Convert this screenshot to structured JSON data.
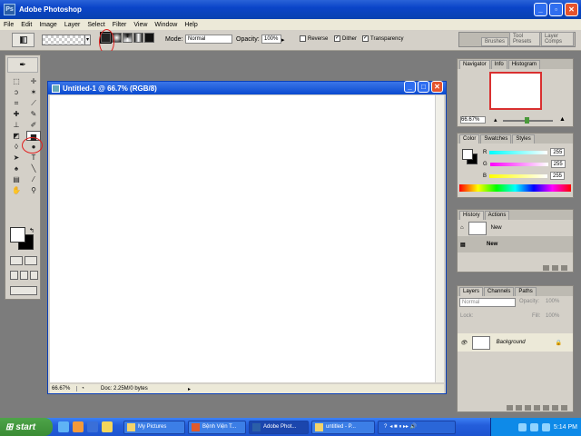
{
  "app": {
    "title": "Adobe Photoshop"
  },
  "menu": [
    "File",
    "Edit",
    "Image",
    "Layer",
    "Select",
    "Filter",
    "View",
    "Window",
    "Help"
  ],
  "options": {
    "mode_label": "Mode:",
    "mode_value": "Normal",
    "opacity_label": "Opacity:",
    "opacity_value": "100%",
    "reverse_label": "Reverse",
    "dither_label": "Dither",
    "transparency_label": "Transparency",
    "palette_well_tabs": [
      "Brushes",
      "Tool Presets",
      "Layer Comps"
    ]
  },
  "document": {
    "title": "Untitled-1 @ 66.7% (RGB/8)",
    "zoom": "66.67%",
    "doc_info": "Doc: 2.25M/0 bytes"
  },
  "navigator": {
    "tabs": [
      "Navigator",
      "Info",
      "Histogram"
    ],
    "zoom": "66.67%"
  },
  "color_panel": {
    "tabs": [
      "Color",
      "Swatches",
      "Styles"
    ],
    "r_label": "R",
    "r_value": "255",
    "g_label": "G",
    "g_value": "255",
    "b_label": "B",
    "b_value": "255"
  },
  "history": {
    "tabs": [
      "History",
      "Actions"
    ],
    "snapshot_label": "New",
    "state_label": "New"
  },
  "layers": {
    "tabs": [
      "Layers",
      "Channels",
      "Paths"
    ],
    "blend_mode": "Normal",
    "opacity_label": "Opacity:",
    "opacity_value": "100%",
    "lock_label": "Lock:",
    "fill_label": "Fill:",
    "fill_value": "100%",
    "layer_name": "Background"
  },
  "taskbar": {
    "start_label": "start",
    "tasks": [
      "My Pictures",
      "Bệnh Viện T...",
      "Adobe Phot...",
      "untitled - P..."
    ],
    "clock": "5:14 PM"
  },
  "colors": {
    "titlebar": "#0a44c8",
    "workspace": "#7c7c7c",
    "annotation": "#e02020"
  }
}
